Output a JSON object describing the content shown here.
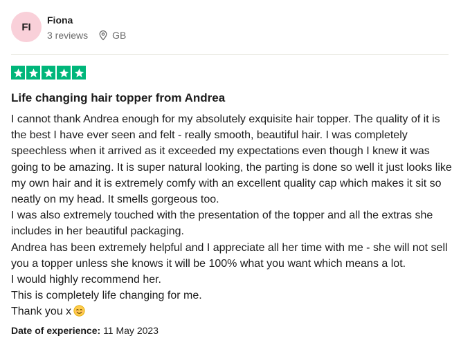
{
  "reviewer": {
    "initials": "FI",
    "name": "Fiona",
    "reviews": "3 reviews",
    "country": "GB",
    "avatar_color": "#f9d0d9"
  },
  "rating": {
    "stars": 5,
    "max": 5,
    "color": "#00b67a"
  },
  "review": {
    "title": "Life changing hair topper from Andrea",
    "paragraphs": [
      "I cannot thank Andrea enough for my absolutely exquisite hair topper. The quality of it is the best I have ever seen and felt - really smooth, beautiful hair. I was completely speechless when it arrived as it exceeded my expectations even though I knew it was going to be amazing. It is super natural looking, the parting is done so well it just looks like my own hair and it is extremely comfy with an excellent quality cap which makes it sit so neatly on my head. It smells gorgeous too.",
      "I was also extremely touched with the presentation of the topper and all the extras she includes in her beautiful packaging.",
      "Andrea has been extremely helpful and I appreciate all her time with me - she will not sell you a topper unless she knows it will be 100% what you want which means a lot.",
      "I would highly recommend her.",
      "This is completely life changing for me.",
      "Thank you x"
    ],
    "closing_emoji": "smiling-face-icon"
  },
  "experience": {
    "label": "Date of experience:",
    "date": "11 May 2023"
  }
}
